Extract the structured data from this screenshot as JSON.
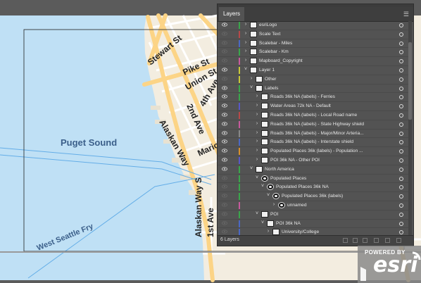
{
  "map": {
    "water_label": "Puget Sound",
    "ferry_label": "West Seattle Fry",
    "street_labels": [
      "Stewart St",
      "Pike St",
      "Union St",
      "4th Ave",
      "2nd Ave",
      "Alaskan Way",
      "Mario",
      "Alaskan Way S",
      "1st Ave"
    ],
    "colors": {
      "water": "#bfe0f5",
      "land": "#f3ede0",
      "major_road": "#fcd486",
      "minor_road": "#ffffff",
      "background": "#5b5b5b"
    }
  },
  "panel": {
    "tab_label": "Layers",
    "menu_icon": "hamburger-menu-icon",
    "footer_count": "6 Layers",
    "layers": [
      {
        "label": "esriLogo",
        "depth": 0,
        "expanded": false,
        "color": "#3aa64b",
        "visible": true,
        "thumb": "light"
      },
      {
        "label": "Scale Text",
        "depth": 0,
        "expanded": false,
        "color": "#b94848",
        "visible": false,
        "thumb": "light"
      },
      {
        "label": "Scalebar - Miles",
        "depth": 0,
        "expanded": false,
        "color": "#4b68c4",
        "visible": false,
        "thumb": "light"
      },
      {
        "label": "Scalebar - Km",
        "depth": 0,
        "expanded": false,
        "color": "#3aa64b",
        "visible": false,
        "thumb": "light"
      },
      {
        "label": "Mapboard_Copyright",
        "depth": 0,
        "expanded": false,
        "color": "#c85a9d",
        "visible": false,
        "thumb": "light"
      },
      {
        "label": "Layer 1",
        "depth": 0,
        "expanded": true,
        "color": "#c8c838",
        "visible": true,
        "thumb": "light"
      },
      {
        "label": "Other",
        "depth": 1,
        "expanded": false,
        "color": "#c8c838",
        "visible": false,
        "thumb": "light"
      },
      {
        "label": "Labels",
        "depth": 1,
        "expanded": true,
        "color": "#3aa64b",
        "visible": true,
        "thumb": "light"
      },
      {
        "label": "Roads 36k NA (labels) - Ferries",
        "depth": 2,
        "expanded": false,
        "color": "#3aa64b",
        "visible": true,
        "thumb": "light"
      },
      {
        "label": "Water Areas 72k NA - Default",
        "depth": 2,
        "expanded": false,
        "color": "#5858c8",
        "visible": true,
        "thumb": "light"
      },
      {
        "label": "Roads 36k NA (labels) - Local Road name",
        "depth": 2,
        "expanded": false,
        "color": "#b94848",
        "visible": true,
        "thumb": "light"
      },
      {
        "label": "Roads 36k NA (labels) - State Highway shield",
        "depth": 2,
        "expanded": false,
        "color": "#c85a9d",
        "visible": true,
        "thumb": "light"
      },
      {
        "label": "Roads 36k NA (labels) - Major/Minor Arteria...",
        "depth": 2,
        "expanded": false,
        "color": "#888888",
        "visible": true,
        "thumb": "light"
      },
      {
        "label": "Roads 36k NA (labels) - Interstate shield",
        "depth": 2,
        "expanded": false,
        "color": "#4b68c4",
        "visible": true,
        "thumb": "light"
      },
      {
        "label": "Populated Places 36k (labels) - Population ...",
        "depth": 2,
        "expanded": false,
        "color": "#d8902a",
        "visible": true,
        "thumb": "light"
      },
      {
        "label": "POI 36k NA - Other POI",
        "depth": 2,
        "expanded": false,
        "color": "#5858c8",
        "visible": true,
        "thumb": "light"
      },
      {
        "label": "North America",
        "depth": 1,
        "expanded": true,
        "color": "#3aa64b",
        "visible": true,
        "thumb": "light"
      },
      {
        "label": "Populated Places",
        "depth": 2,
        "expanded": true,
        "color": "#3aa64b",
        "visible": false,
        "thumb": "dark"
      },
      {
        "label": "Populated Places 36k NA",
        "depth": 3,
        "expanded": true,
        "color": "#3aa64b",
        "visible": false,
        "thumb": "dark"
      },
      {
        "label": "Populated Places 36k (labels)",
        "depth": 4,
        "expanded": true,
        "color": "#3aa64b",
        "visible": false,
        "thumb": "dark"
      },
      {
        "label": "unnamed",
        "depth": 5,
        "expanded": false,
        "color": "#c85a9d",
        "visible": false,
        "thumb": "dark"
      },
      {
        "label": "POI",
        "depth": 2,
        "expanded": true,
        "color": "#3aa64b",
        "visible": false,
        "thumb": "light"
      },
      {
        "label": "POI 36k NA",
        "depth": 3,
        "expanded": true,
        "color": "#4b68c4",
        "visible": false,
        "thumb": "light"
      },
      {
        "label": "University/College",
        "depth": 4,
        "expanded": false,
        "color": "#4b68c4",
        "visible": false,
        "thumb": "light"
      }
    ]
  },
  "watermark": {
    "powered_by": "POWERED BY",
    "brand": "esri"
  }
}
